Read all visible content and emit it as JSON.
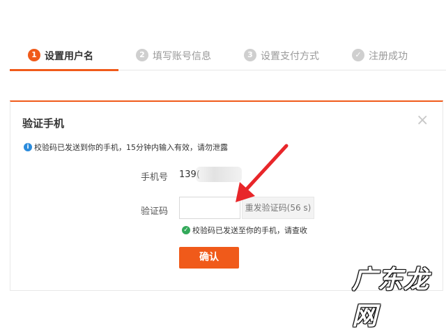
{
  "steps": [
    {
      "num": "1",
      "label": "设置用户名"
    },
    {
      "num": "2",
      "label": "填写账号信息"
    },
    {
      "num": "3",
      "label": "设置支付方式"
    },
    {
      "num": "✓",
      "label": "注册成功"
    }
  ],
  "dialog": {
    "title": "验证手机",
    "close": "×",
    "info_icon": "i",
    "info_text": "校验码已发送到你的手机，15分钟内输入有效，请勿泄露",
    "phone_label": "手机号",
    "phone_value": "139(",
    "code_label": "验证码",
    "code_value": "",
    "resend_button": "重发验证码(56 s)",
    "success_icon": "✓",
    "success_text": "校验码已发送至你的手机，请查收",
    "confirm_button": "确认"
  },
  "watermark": "广东龙网",
  "colors": {
    "accent": "#f05a1a",
    "info": "#2a8bdc",
    "success": "#33a95a",
    "arrow": "#e8262a"
  }
}
